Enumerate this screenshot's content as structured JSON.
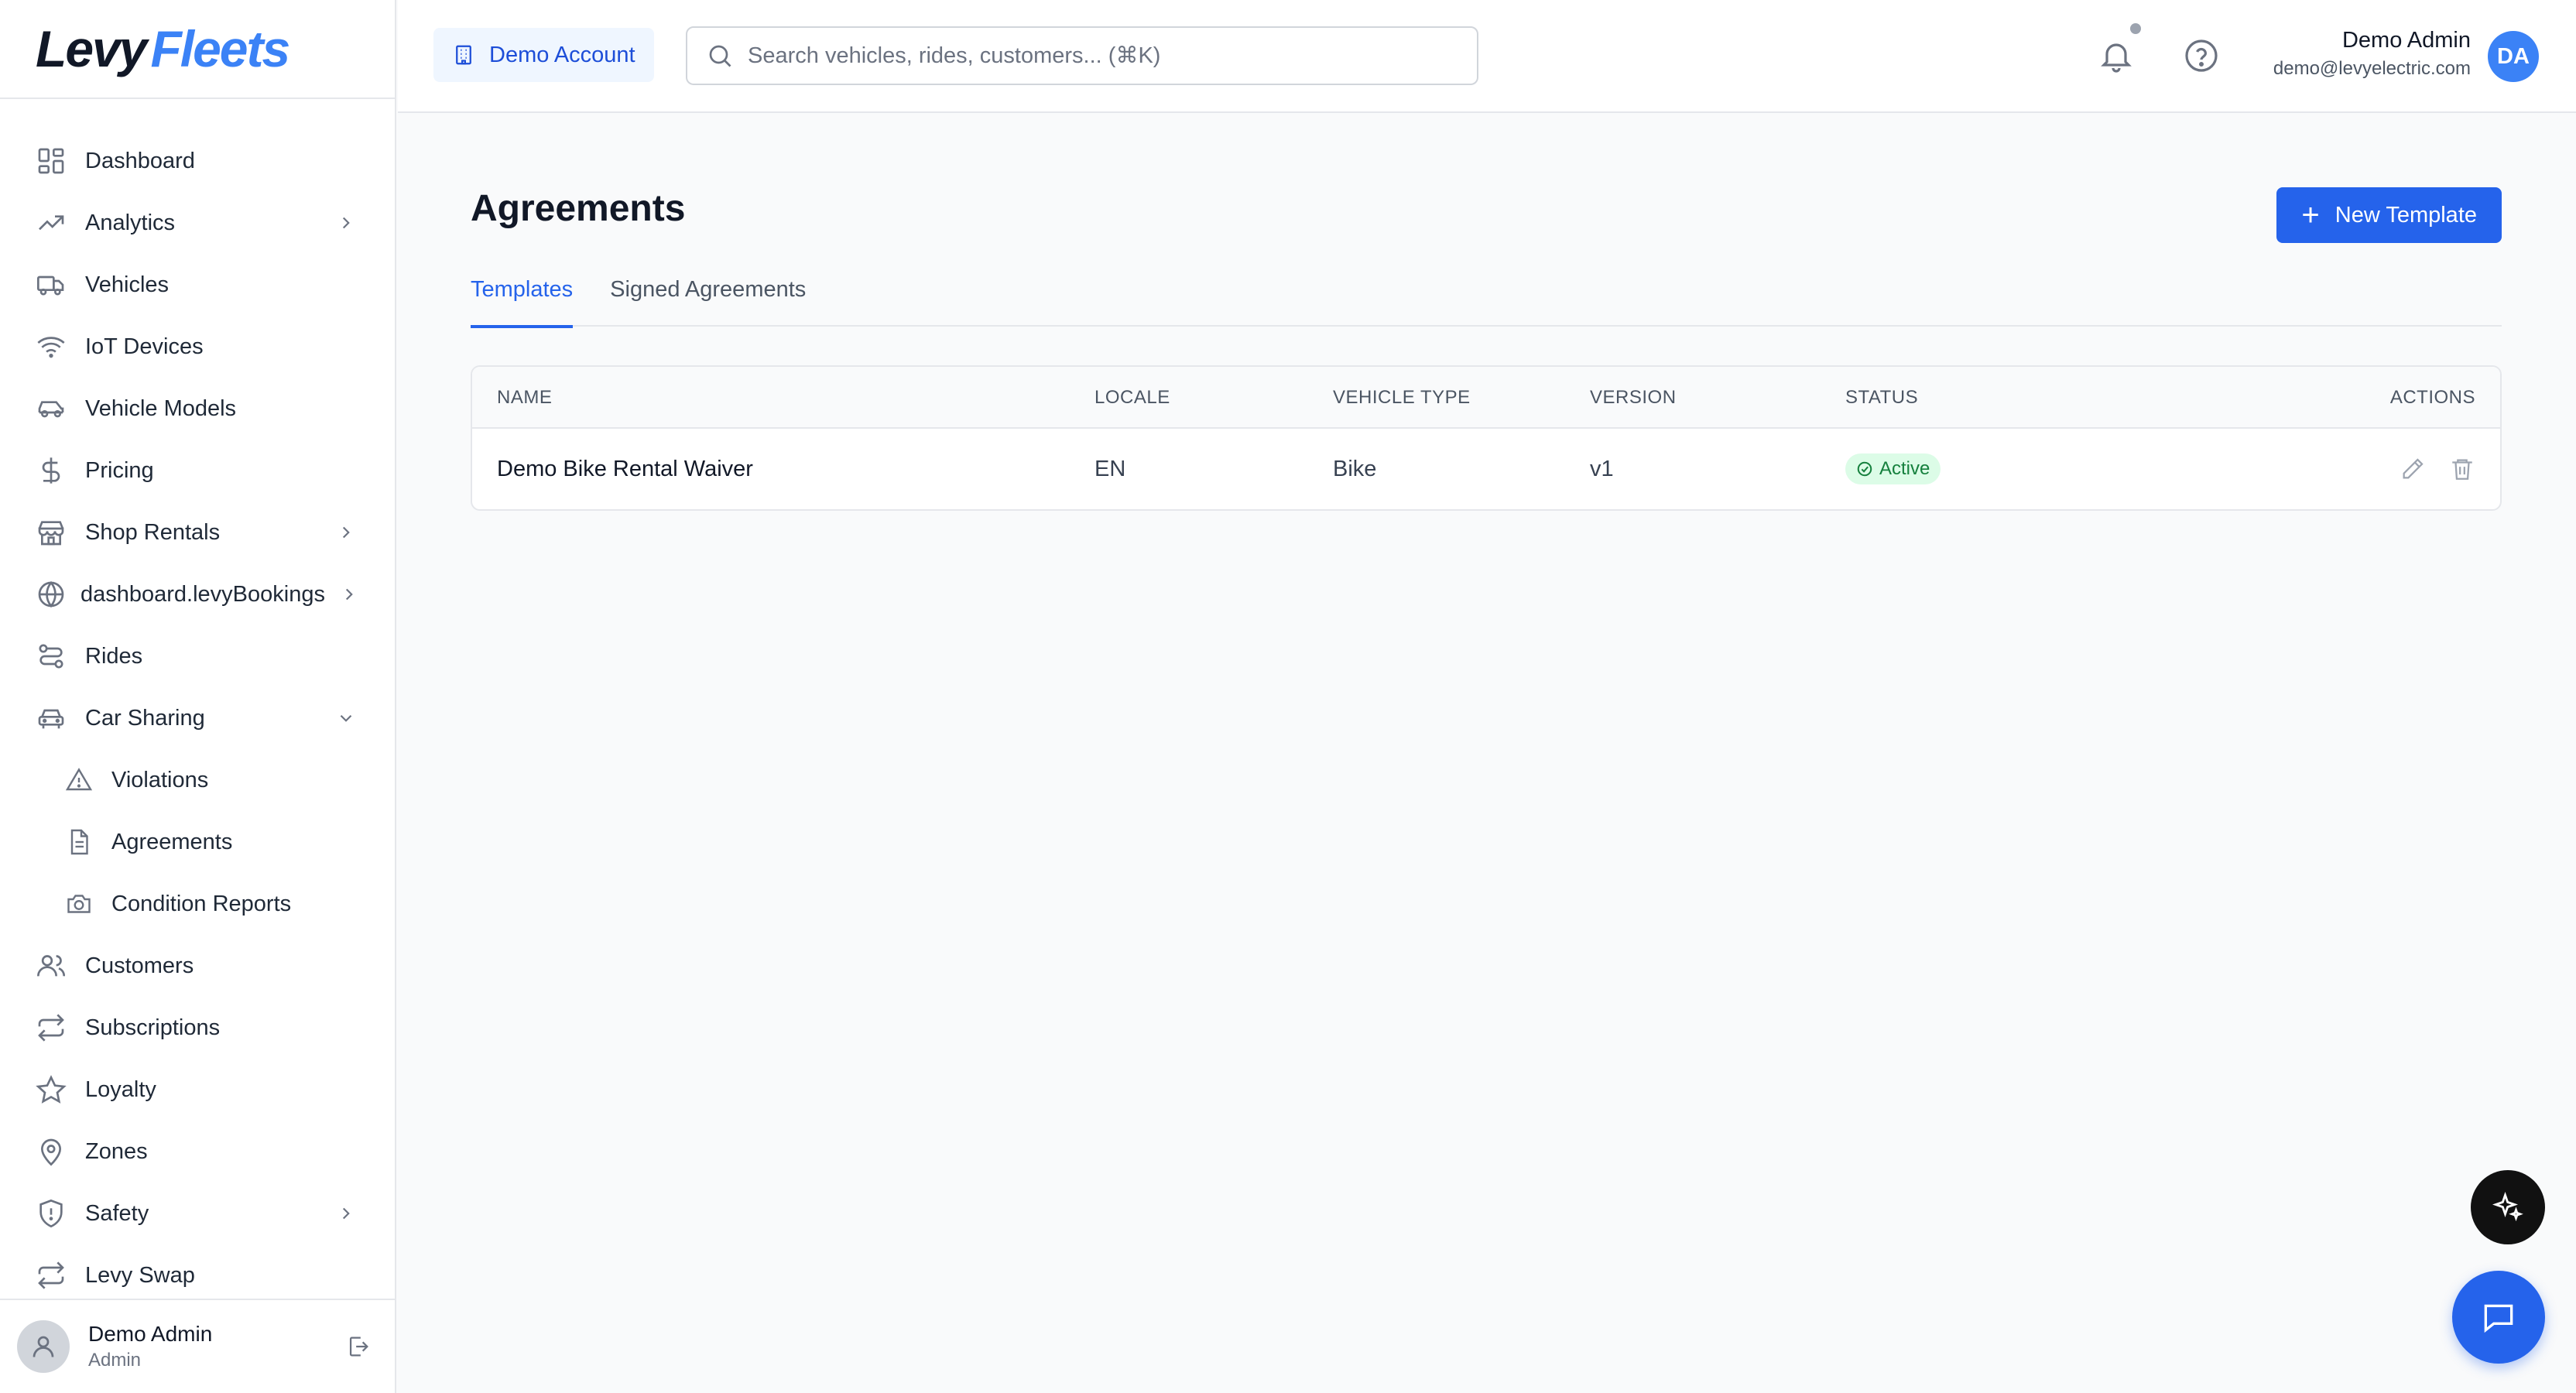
{
  "brand": {
    "levy": "Levy",
    "fleets": "Fleets"
  },
  "sidebar": {
    "items": [
      {
        "label": "Dashboard",
        "icon": "dashboard-grid-icon"
      },
      {
        "label": "Analytics",
        "icon": "trending-up-icon",
        "chevron": "right"
      },
      {
        "label": "Vehicles",
        "icon": "truck-icon"
      },
      {
        "label": "IoT Devices",
        "icon": "wifi-icon"
      },
      {
        "label": "Vehicle Models",
        "icon": "car-icon"
      },
      {
        "label": "Pricing",
        "icon": "dollar-icon"
      },
      {
        "label": "Shop Rentals",
        "icon": "store-icon",
        "chevron": "right"
      },
      {
        "label": "dashboard.levyBookings",
        "icon": "globe-icon",
        "chevron": "right"
      },
      {
        "label": "Rides",
        "icon": "route-icon"
      },
      {
        "label": "Car Sharing",
        "icon": "car-icon",
        "chevron": "down"
      },
      {
        "label": "Violations",
        "icon": "warning-triangle-icon",
        "sub": true
      },
      {
        "label": "Agreements",
        "icon": "document-icon",
        "sub": true
      },
      {
        "label": "Condition Reports",
        "icon": "camera-icon",
        "sub": true
      },
      {
        "label": "Customers",
        "icon": "users-icon"
      },
      {
        "label": "Subscriptions",
        "icon": "repeat-icon"
      },
      {
        "label": "Loyalty",
        "icon": "star-icon"
      },
      {
        "label": "Zones",
        "icon": "map-pin-icon"
      },
      {
        "label": "Safety",
        "icon": "shield-icon",
        "chevron": "right"
      },
      {
        "label": "Levy Swap",
        "icon": "repeat-icon"
      }
    ],
    "footer": {
      "name": "Demo Admin",
      "role": "Admin"
    }
  },
  "header": {
    "account_label": "Demo Account",
    "search_placeholder": "Search vehicles, rides, customers... (⌘K)",
    "user_name": "Demo Admin",
    "user_email": "demo@levyelectric.com",
    "avatar_initials": "DA"
  },
  "main": {
    "title": "Agreements",
    "new_button_label": "New Template",
    "tabs": [
      {
        "label": "Templates",
        "active": true
      },
      {
        "label": "Signed Agreements",
        "active": false
      }
    ],
    "table": {
      "columns": [
        "NAME",
        "LOCALE",
        "VEHICLE TYPE",
        "VERSION",
        "STATUS",
        "ACTIONS"
      ],
      "rows": [
        {
          "name": "Demo Bike Rental Waiver",
          "locale": "EN",
          "vehicle_type": "Bike",
          "version": "v1",
          "status": "Active"
        }
      ]
    }
  },
  "colors": {
    "accent": "#2563eb",
    "brand_blue": "#3b82f6",
    "status_active_bg": "#dcfce7",
    "status_active_text": "#15803d"
  }
}
